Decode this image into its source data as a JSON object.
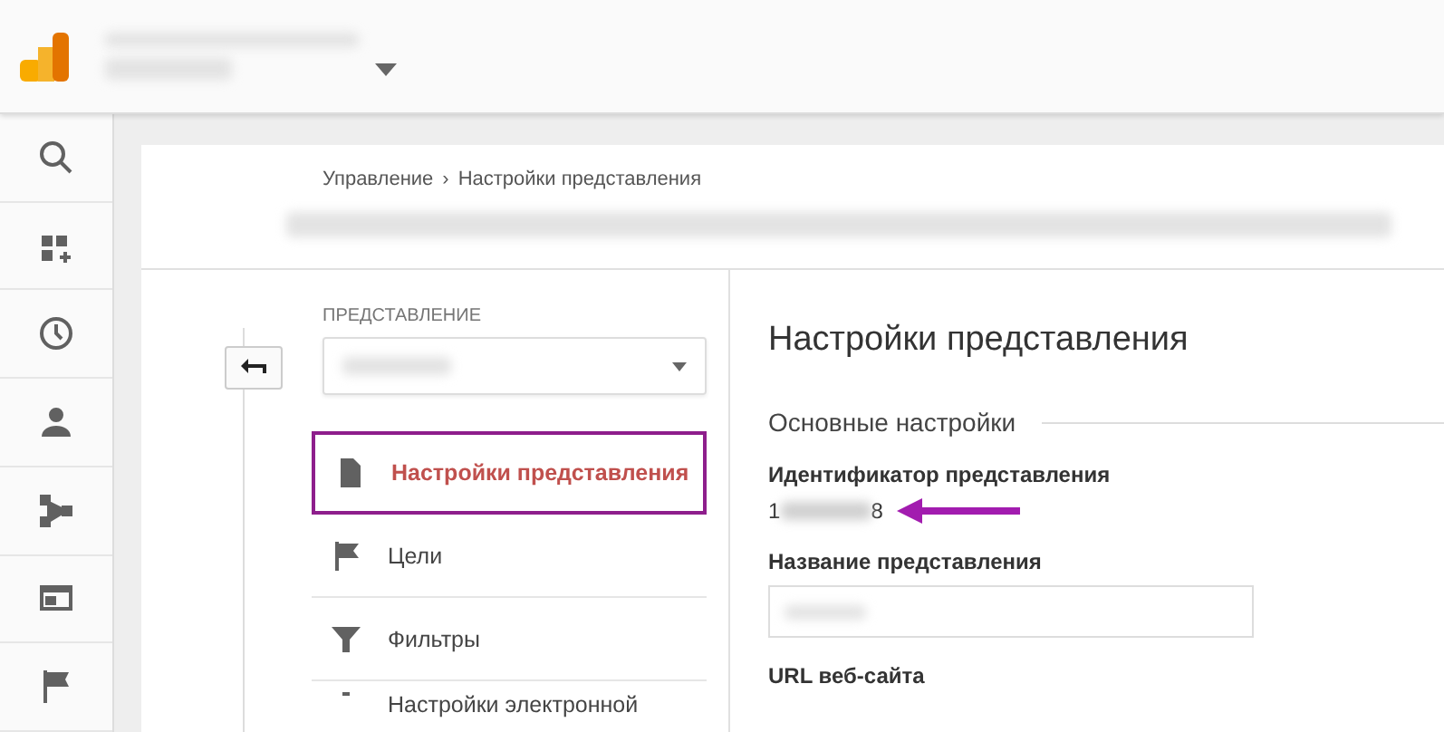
{
  "breadcrumb": {
    "items": [
      "Управление",
      "Настройки представления"
    ],
    "separator": "›"
  },
  "view_section": {
    "label": "ПРЕДСТАВЛЕНИЕ"
  },
  "nav_items": [
    {
      "label": "Настройки представления",
      "selected": true
    },
    {
      "label": "Цели",
      "selected": false
    },
    {
      "label": "Фильтры",
      "selected": false
    },
    {
      "label": "Настройки электронной",
      "selected": false
    }
  ],
  "main": {
    "title": "Настройки представления",
    "section": "Основные настройки",
    "fields": [
      {
        "kind": "id",
        "label": "Идентификатор представления",
        "value_start": "1",
        "value_end": "8"
      },
      {
        "kind": "input",
        "label": "Название представления"
      },
      {
        "kind": "input_cut",
        "label": "URL веб-сайта"
      }
    ]
  }
}
